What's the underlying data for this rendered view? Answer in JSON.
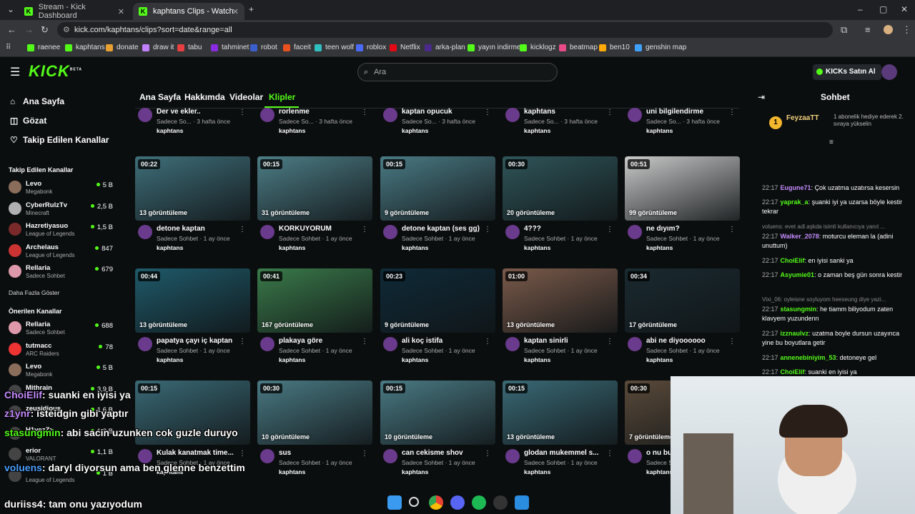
{
  "browser": {
    "tabs": [
      {
        "title": "Stream - Kick Dashboard"
      },
      {
        "title": "kaphtans Clips - Watch Live on"
      }
    ],
    "url": "kick.com/kaphtans/clips?sort=date&range=all",
    "bookmarks": [
      "raenee",
      "kaphtans",
      "donate",
      "draw it",
      "tabu",
      "tahminet",
      "robot",
      "faceit",
      "teen wolf",
      "roblox",
      "Netflix",
      "arka-plan",
      "yayın indirme",
      "kicklogz",
      "beatmap",
      "ben10",
      "genshin map"
    ]
  },
  "header": {
    "logo": "KICK",
    "logo_badge": "BETA",
    "search_placeholder": "Ara",
    "kicks_button": "KICKs Satın Al"
  },
  "sidebar": {
    "nav": [
      "Ana Sayfa",
      "Gözat",
      "Takip Edilen Kanallar"
    ],
    "followed_heading": "Takip Edilen Kanallar",
    "followed": [
      {
        "name": "Levo",
        "game": "Megabonk",
        "viewers": "5 B",
        "color": "#8a6d5a"
      },
      {
        "name": "CyberRulzTv",
        "game": "Minecraft",
        "viewers": "2,5 B",
        "color": "#b0b0b0"
      },
      {
        "name": "Hazretiyasuo",
        "game": "League of Legends",
        "viewers": "1,5 B",
        "color": "#7a2a2a"
      },
      {
        "name": "Archelaus",
        "game": "League of Legends",
        "viewers": "847",
        "color": "#c33"
      },
      {
        "name": "Rellaria",
        "game": "Sadece Sohbet",
        "viewers": "679",
        "color": "#d9a"
      }
    ],
    "show_more": "Daha Fazla Göster",
    "recommended_heading": "Önerilen Kanallar",
    "recommended": [
      {
        "name": "Rellaria",
        "game": "Sadece Sohbet",
        "viewers": "688",
        "color": "#d9a"
      },
      {
        "name": "tutmacc",
        "game": "ARC Raiders",
        "viewers": "78",
        "color": "#e33"
      },
      {
        "name": "Levo",
        "game": "Megabonk",
        "viewers": "5 B",
        "color": "#8a6d5a"
      },
      {
        "name": "Mithrain",
        "game": "",
        "viewers": "3,9 B",
        "color": "#444"
      },
      {
        "name": "zeusidious",
        "game": "",
        "viewers": "1,6 B",
        "color": "#444"
      },
      {
        "name": "H1vezZz",
        "game": "",
        "viewers": "1,2 B",
        "color": "#444"
      },
      {
        "name": "erior",
        "game": "VALORANT",
        "viewers": "1,1 B",
        "color": "#444"
      },
      {
        "name": "",
        "game": "League of Legends",
        "viewers": "1 B",
        "color": "#444"
      }
    ]
  },
  "profile_tabs": [
    "Ana Sayfa",
    "Hakkımda",
    "Videolar",
    "Klipler"
  ],
  "clips": {
    "top_row": [
      {
        "title": "Der ve ekler..",
        "meta": "Sadece So... · 3 hafta önce",
        "channel": "kaphtans"
      },
      {
        "title": "rorlenme",
        "meta": "Sadece So... · 3 hafta önce",
        "channel": "kaphtans"
      },
      {
        "title": "kaptan opucuk",
        "meta": "Sadece So... · 3 hafta önce",
        "channel": "kaphtans"
      },
      {
        "title": "kaphtans",
        "meta": "Sadece So... · 3 hafta önce",
        "channel": "kaphtans"
      },
      {
        "title": "uni bilgilendirme",
        "meta": "Sadece So... · 3 hafta önce",
        "channel": "kaphtans"
      }
    ],
    "rows": [
      [
        {
          "duration": "00:22",
          "views": "13 görüntüleme",
          "title": "detone kaptan",
          "meta": "Sadece Sohbet · 1 ay önce",
          "channel": "kaphtans",
          "thumb": "#3f6f7a"
        },
        {
          "duration": "00:15",
          "views": "31 görüntüleme",
          "title": "KORKUYORUM",
          "meta": "Sadece Sohbet · 1 ay önce",
          "channel": "kaphtans",
          "thumb": "#4d7d86"
        },
        {
          "duration": "00:15",
          "views": "9 görüntüleme",
          "title": "detone kaptan (ses gg)",
          "meta": "Sadece Sohbet · 1 ay önce",
          "channel": "kaphtans",
          "thumb": "#4a7a84"
        },
        {
          "duration": "00:30",
          "views": "20 görüntüleme",
          "title": "4???",
          "meta": "Sadece Sohbet · 1 ay önce",
          "channel": "kaphtans",
          "thumb": "#2f5559"
        },
        {
          "duration": "00:51",
          "views": "99 görüntüleme",
          "title": "ne dıyım?",
          "meta": "Sadece Sohbet · 1 ay önce",
          "channel": "kaphtans",
          "thumb": "#c9c9c9"
        }
      ],
      [
        {
          "duration": "00:44",
          "views": "13 görüntüleme",
          "title": "papatya çayı iç kaptan",
          "meta": "Sadece Sohbet · 1 ay önce",
          "channel": "kaphtans",
          "thumb": "#1f5a6a"
        },
        {
          "duration": "00:41",
          "views": "167 görüntüleme",
          "title": "plakaya göre",
          "meta": "Sadece Sohbet · 1 ay önce",
          "channel": "kaphtans",
          "thumb": "#3a7a4a"
        },
        {
          "duration": "00:23",
          "views": "9 görüntüleme",
          "title": "ali koç istifa",
          "meta": "Sadece Sohbet · 1 ay önce",
          "channel": "kaphtans",
          "thumb": "#0f2a38"
        },
        {
          "duration": "01:00",
          "views": "13 görüntüleme",
          "title": "kaptan sinirli",
          "meta": "Sadece Sohbet · 1 ay önce",
          "channel": "kaphtans",
          "thumb": "#7a5a4a"
        },
        {
          "duration": "00:34",
          "views": "17 görüntüleme",
          "title": "abi ne diyoooooo",
          "meta": "Sadece Sohbet · 1 ay önce",
          "channel": "kaphtans",
          "thumb": "#1a2a30"
        }
      ],
      [
        {
          "duration": "00:15",
          "views": "",
          "title": "Kulak kanatmak time...",
          "meta": "Sadece Sohbet · 1 ay önce",
          "channel": "kaphtans",
          "thumb": "#3a6a76"
        },
        {
          "duration": "00:30",
          "views": "10 görüntüleme",
          "title": "sus",
          "meta": "Sadece Sohbet · 1 ay önce",
          "channel": "kaphtans",
          "thumb": "#4a7a84"
        },
        {
          "duration": "00:15",
          "views": "10 görüntüleme",
          "title": "can cekisme shov",
          "meta": "Sadece Sohbet · 1 ay önce",
          "channel": "kaphtans",
          "thumb": "#4a7a84"
        },
        {
          "duration": "00:15",
          "views": "13 görüntüleme",
          "title": "glodan mukemmel s...",
          "meta": "Sadece Sohbet · 1 ay önce",
          "channel": "kaphtans",
          "thumb": "#3a6a76"
        },
        {
          "duration": "00:30",
          "views": "7 görüntüleme",
          "title": "o nu bu",
          "meta": "Sadece Sohbet · 1 ay önce",
          "channel": "kaphtans",
          "thumb": "#5a4a3a"
        }
      ]
    ]
  },
  "chat": {
    "title": "Sohbet",
    "gift_user": "FeyzaaTT",
    "gift_count": "1",
    "gift_text": "1 abonelik hediye ederek 2. sıraya yükselin",
    "messages": [
      {
        "time": "22:17",
        "user": "Eugune71",
        "color": "#c58cff",
        "text": "Çok uzatma uzatırsa kesersin",
        "reply": ""
      },
      {
        "time": "22:17",
        "user": "yaprak_a",
        "color": "#53fc18",
        "text": "şuanki iyi ya uzarsa böyle kestir tekrar",
        "reply": ""
      },
      {
        "time": "22:17",
        "user": "Walker_2078",
        "color": "#c58cff",
        "text": "moturcu eleman la (adini unuttum)",
        "reply": "voluens: evet adl.aşkda isimli kullanıcıya yanıt ..."
      },
      {
        "time": "22:17",
        "user": "ChoiElif",
        "color": "#53fc18",
        "text": "en iyisi sanki ya",
        "reply": ""
      },
      {
        "time": "22:17",
        "user": "Asyumie01",
        "color": "#53fc18",
        "text": "o zaman beş gün sonra kestir",
        "reply": ""
      },
      {
        "time": "22:17",
        "user": "stasungmin",
        "color": "#53fc18",
        "text": "he tiamm biliyodum zaten klavyem yuzundenn",
        "reply": "Vixi_06: oyleisne soyluyom heeseung diye yazi..."
      },
      {
        "time": "22:17",
        "user": "izznaulvz",
        "color": "#53fc18",
        "text": "uzatma boyle dursun uzayınca yine bu boyutlara getir",
        "reply": ""
      },
      {
        "time": "22:17",
        "user": "annenebiniyim_53",
        "color": "#53fc18",
        "text": "detoneye gel",
        "reply": ""
      },
      {
        "time": "22:17",
        "user": "ChoiElif",
        "color": "#53fc18",
        "text": "suanki en iyisi ya",
        "reply": ""
      },
      {
        "time": "22:17",
        "user": "z1ynr",
        "color": "#53fc18",
        "text": "isteidgin gibi yaptır",
        "reply": ""
      },
      {
        "time": "22:17",
        "user": "stasungmin",
        "color": "#53fc18",
        "text": "abi sacin uzunken cok guzle duruyo",
        "reply": ""
      }
    ]
  },
  "overlay": [
    {
      "user": "ChoiElif",
      "text": ": suanki en iyisi ya",
      "color": "#c58cff"
    },
    {
      "user": "z1ynr",
      "text": ": isteidgin gibi yaptır",
      "color": "#c58cff"
    },
    {
      "user": "stasungmin",
      "text": ": abi sacin uzunken cok guzle duruyo",
      "color": "#53fc18"
    },
    {
      "user": "voluens",
      "text": ": daryl diyorsun ama ben glenne benzettim",
      "color": "#4aa0ff"
    },
    {
      "user": "duriiss4",
      "text": ": tam onu yazıyodum",
      "color": "#fff"
    }
  ],
  "colors": {
    "accent": "#53fc18",
    "bg": "#0b0e0f"
  }
}
